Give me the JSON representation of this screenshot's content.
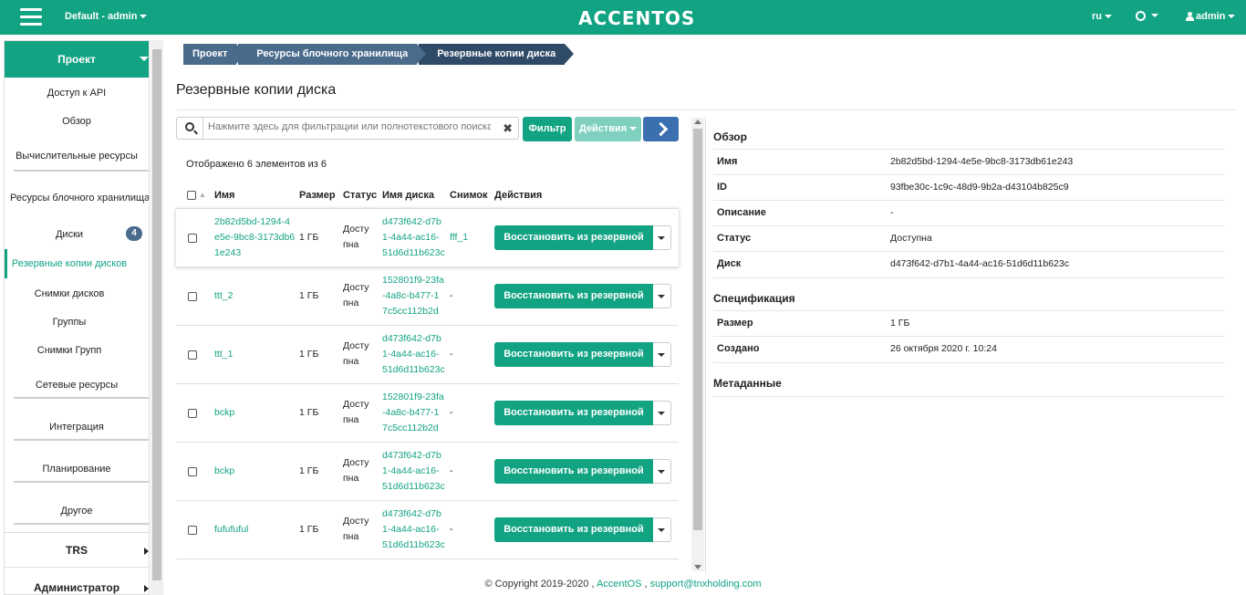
{
  "header": {
    "project_menu": "Default - admin",
    "logo": "ACCENTOS",
    "lang": "ru",
    "user": "admin"
  },
  "sidebar": {
    "section": "Проект",
    "items": [
      "Доступ к API",
      "Обзор",
      "Вычислительные ресурсы",
      "Ресурсы блочного хранилища",
      "Диски",
      "Резервные копии дисков",
      "Снимки дисков",
      "Группы",
      "Снимки Групп",
      "Сетевые ресурсы",
      "Интеграция",
      "Планирование",
      "Другое"
    ],
    "disks_badge": "4",
    "groups": [
      "TRS",
      "Администратор"
    ]
  },
  "breadcrumb": [
    "Проект",
    "Ресурсы блочного хранилища",
    "Резервные копии диска"
  ],
  "page": {
    "title": "Резервные копии диска",
    "search_placeholder": "Нажмите здесь для фильтрации или полнотекстового поиска.",
    "filter_label": "Фильтр",
    "actions_label": "Действия",
    "count_text": "Отображено 6 элементов из 6"
  },
  "table": {
    "headers": [
      "Имя",
      "Размер",
      "Статус",
      "Имя диска",
      "Снимок",
      "Действия"
    ],
    "restore_label": "Восстановить из резервной копии",
    "rows": [
      {
        "name": [
          "2b82d5bd-1294-4",
          "e5e-9bc8-3173db6",
          "1e243"
        ],
        "size": "1 ГБ",
        "status": [
          "Досту",
          "пна"
        ],
        "disk": [
          "d473f642-d7b",
          "1-4a44-ac16-",
          "51d6d11b623c"
        ],
        "snapshot": "fff_1"
      },
      {
        "name": [
          "ttt_2"
        ],
        "size": "1 ГБ",
        "status": [
          "Досту",
          "пна"
        ],
        "disk": [
          "152801f9-23fa",
          "-4a8c-b477-1",
          "7c5cc112b2d"
        ],
        "snapshot": "-"
      },
      {
        "name": [
          "ttt_1"
        ],
        "size": "1 ГБ",
        "status": [
          "Досту",
          "пна"
        ],
        "disk": [
          "d473f642-d7b",
          "1-4a44-ac16-",
          "51d6d11b623c"
        ],
        "snapshot": "-"
      },
      {
        "name": [
          "bckp"
        ],
        "size": "1 ГБ",
        "status": [
          "Досту",
          "пна"
        ],
        "disk": [
          "152801f9-23fa",
          "-4a8c-b477-1",
          "7c5cc112b2d"
        ],
        "snapshot": "-"
      },
      {
        "name": [
          "bckp"
        ],
        "size": "1 ГБ",
        "status": [
          "Досту",
          "пна"
        ],
        "disk": [
          "d473f642-d7b",
          "1-4a44-ac16-",
          "51d6d11b623c"
        ],
        "snapshot": "-"
      },
      {
        "name": [
          "fufufuful"
        ],
        "size": "1 ГБ",
        "status": [
          "Досту",
          "пна"
        ],
        "disk": [
          "d473f642-d7b",
          "1-4a44-ac16-",
          "51d6d11b623c"
        ],
        "snapshot": "-"
      }
    ]
  },
  "detail": {
    "overview_title": "Обзор",
    "overview": [
      {
        "label": "Имя",
        "value": "2b82d5bd-1294-4e5e-9bc8-3173db61e243"
      },
      {
        "label": "ID",
        "value": "93fbe30c-1c9c-48d9-9b2a-d43104b825c9"
      },
      {
        "label": "Описание",
        "value": "-"
      },
      {
        "label": "Статус",
        "value": "Доступна"
      },
      {
        "label": "Диск",
        "value": "d473f642-d7b1-4a44-ac16-51d6d11b623c"
      }
    ],
    "spec_title": "Спецификация",
    "spec": [
      {
        "label": "Размер",
        "value": "1 ГБ"
      },
      {
        "label": "Создано",
        "value": "26 октября 2020 г. 10:24"
      }
    ],
    "meta_title": "Метаданные"
  },
  "footer": {
    "copyright": "© Copyright 2019-2020 ,",
    "brand": "AccentOS",
    "sep": ",",
    "email": "support@tnxholding.com"
  }
}
